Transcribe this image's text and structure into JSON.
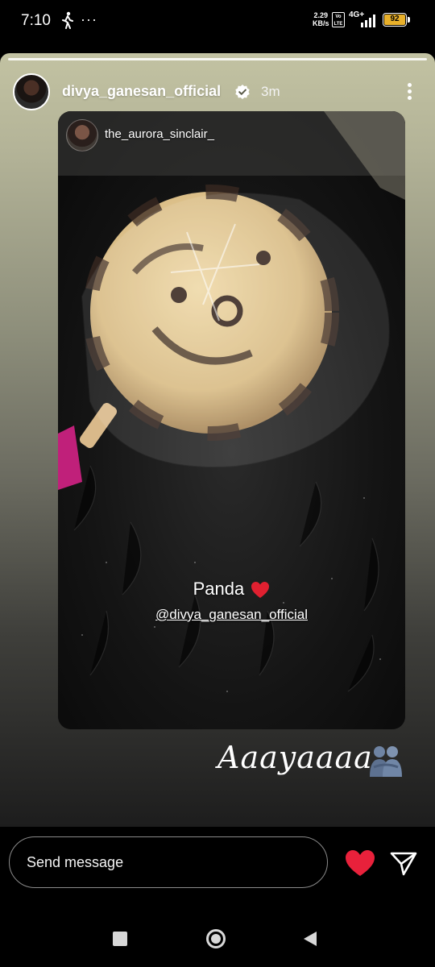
{
  "status_bar": {
    "time": "7:10",
    "more": "···",
    "net_speed_value": "2.29",
    "net_speed_unit": "KB/s",
    "volte": "Vo LTE",
    "network": "4G+",
    "battery": "92"
  },
  "story": {
    "username": "divya_ganesan_official",
    "time_ago": "3m",
    "text": "Aaayaaaa",
    "shared_post": {
      "username": "the_aurora_sinclair_",
      "caption": "Panda",
      "mention": "@divya_ganesan_official"
    }
  },
  "footer": {
    "message_placeholder": "Send message"
  },
  "colors": {
    "like": "#e8213b",
    "battery": "#e8b02a",
    "verified": "#3897f0"
  }
}
